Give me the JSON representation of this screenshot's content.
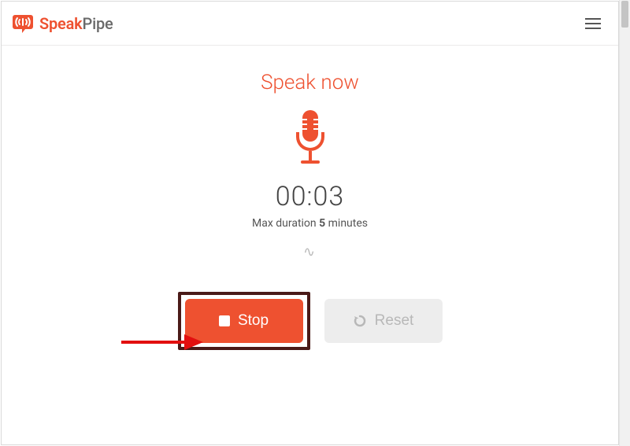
{
  "brand": {
    "part1": "Speak",
    "part2": "Pipe"
  },
  "recorder": {
    "title": "Speak now",
    "timer": "00:03",
    "max_prefix": "Max duration ",
    "max_value": "5",
    "max_suffix": " minutes"
  },
  "buttons": {
    "stop": "Stop",
    "reset": "Reset"
  },
  "colors": {
    "accent": "#ee5130",
    "reset_bg": "#ededed",
    "reset_fg": "#b8b8b8",
    "highlight": "#4a1a18",
    "arrow": "#e20f0f"
  }
}
